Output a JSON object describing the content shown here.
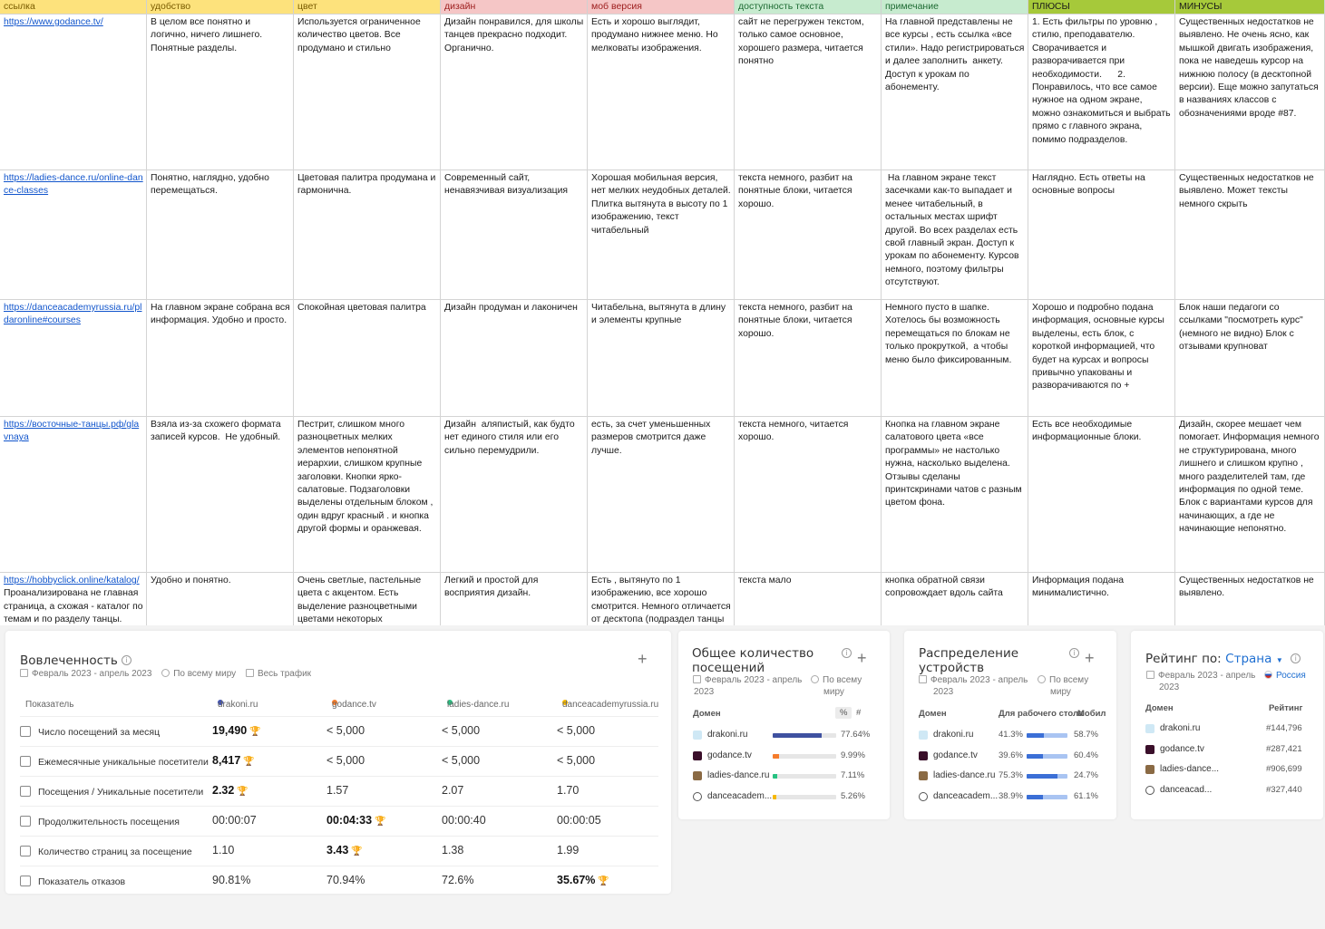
{
  "sheet": {
    "headers": [
      {
        "label": "ссылка",
        "bg": "#fde27c",
        "color": "#7a5c00"
      },
      {
        "label": "удобство",
        "bg": "#fde27c",
        "color": "#7a5c00"
      },
      {
        "label": "цвет",
        "bg": "#fde27c",
        "color": "#7a5c00"
      },
      {
        "label": "дизайн",
        "bg": "#f5c6c6",
        "color": "#9c1c1c"
      },
      {
        "label": "моб версия",
        "bg": "#f5c6c6",
        "color": "#9c1c1c"
      },
      {
        "label": "доступность текста",
        "bg": "#c7ebcf",
        "color": "#1e6b33"
      },
      {
        "label": "примечание",
        "bg": "#c7ebcf",
        "color": "#1e6b33"
      },
      {
        "label": "ПЛЮСЫ",
        "bg": "#a6c93a",
        "color": "#1a1a1a"
      },
      {
        "label": "МИНУСЫ",
        "bg": "#a6c93a",
        "color": "#1a1a1a"
      }
    ],
    "rows": [
      {
        "link": "https://www.godance.tv/",
        "link_note": "",
        "cells": [
          "В целом все понятно и логично, ничего лишнего. Понятные разделы.",
          "Используется ограниченное количество цветов. Все продумано и стильно",
          "Дизайн понравился, для школы танцев прекрасно подходит. Органично.",
          "Есть и хорошо выглядит, продумано нижнее меню. Но мелковаты изображения.",
          "сайт не перегружен текстом, только самое основное, хорошего размера, читается понятно",
          "На главной представлены не все курсы , есть ссылка «все стили». Надо регистрироваться и далее заполнить  анкету. Доступ к урокам по абонементу.",
          "1. Есть фильтры по уровню , стилю, преподавателю. Сворачивается и разворачивается при необходимости.      2. Понравилось, что все самое нужное на одном экране, можно ознакомиться и выбрать прямо с главного экрана, помимо подразделов.",
          "Существенных недостатков не выявлено. Не очень ясно, как мышкой двигать изображения, пока не наведешь курсор на нижнюю полосу (в десктопной версии). Еще можно запутаться в названиях классов с обозначениями вроде #87."
        ]
      },
      {
        "link": "https://ladies-dance.ru/online-dance-classes",
        "link_note": "",
        "cells": [
          "Понятно, наглядно, удобно перемещаться.",
          "Цветовая палитра продумана и гармонична.",
          "Современный сайт, ненавязчивая визуализация",
          "Хорошая мобильная версия, нет мелких неудобных деталей. Плитка вытянута в высоту по 1 изображению, текст читабельный",
          "текста немного, разбит на понятные блоки, читается хорошо.",
          " На главном экране текст засечками как-то выпадает и менее читабельный, в остальных местах шрифт другой. Во всех разделах есть свой главный экран. Доступ к урокам по абонементу. Курсов немного, поэтому фильтры отсутствуют.",
          "Наглядно. Есть ответы на основные вопросы",
          "Существенных недостатков не выявлено. Может тексты немного скрыть"
        ]
      },
      {
        "link": "https://danceacademyrussia.ru/pldaronline#courses",
        "link_note": "",
        "cells": [
          "На главном экране собрана вся информация. Удобно и просто.",
          "Спокойная цветовая палитра",
          "Дизайн продуман и лаконичен",
          "Читабельна, вытянута в длину и элементы крупные",
          "текста немного, разбит на понятные блоки, читается хорошо.",
          "Немного пусто в шапке. Хотелось бы возможность перемещаться по блокам не только прокруткой,  а чтобы меню было фиксированным.",
          "Хорошо и подробно подана информация, основные курсы выделены, есть блок, с короткой информацией, что будет на курсах и вопросы привычно упакованы и разворачиваются по +",
          "Блок наши педагоги со ссылками \"посмотреть курс\" (немного не видно) Блок с отзывами крупноват"
        ]
      },
      {
        "link": "https://восточные-танцы.рф/glavnaya",
        "link_note": "",
        "cells": [
          "Взяла из-за схожего формата записей курсов.  Не удобный.",
          "Пестрит, слишком много разноцветных мелких элементов непонятной иерархии, слишком крупные заголовки. Кнопки ярко-салатовые. Подзаголовки выделены отдельным блоком , один вдруг красный . и кнопка другой формы и оранжевая.",
          "Дизайн  аляпистый, как будто нет единого стиля или его сильно перемудрили.",
          "есть, за счет уменьшенных размеров смотрится даже лучше.",
          "текста немного, читается хорошо.",
          "Кнопка на главном экране салатового цвета «все программы» не настолько нужна, насколько выделена. Отзывы сделаны принтскринами чатов с разным цветом фона.",
          "Есть все необходимые информационные блоки.",
          "Дизайн, скорее мешает чем помогает. Информация немного не структурирована, много лишнего и слишком крупно , много разделителей там, где информация по одной теме. Блок с вариантами курсов для начинающих, а где не начинающие непонятно."
        ]
      },
      {
        "link": "https://hobbyclick.online/katalog/",
        "link_note": "Проанализирована не главная страница, а схожая - каталог по темам и по разделу танцы.",
        "cells": [
          "Удобно и понятно.",
          "Очень светлые, пастельные цвета с акцентом. Есть выделение разноцветными цветами некоторых характеристик -",
          "Легкий и простой для восприятия дизайн.",
          "Есть , вытянуто по 1 изображению, все хорошо смотрится. Немного отличается от десктопа (подраздел танцы",
          "текста мало",
          "кнопка обратной связи сопровождает вдоль сайта",
          "Информация подана минималистично.",
          "Существенных недостатков не выявлено."
        ]
      }
    ]
  },
  "engagement": {
    "title": "Вовлеченность",
    "date_range": "Февраль 2023 - апрель 2023",
    "region": "По всему миру",
    "traffic": "Весь трафик",
    "col_metric": "Показатель",
    "domains": [
      {
        "name": "drakoni.ru",
        "color": "#3f51b5"
      },
      {
        "name": "godance.tv",
        "color": "#f57c2b"
      },
      {
        "name": "ladies-dance.ru",
        "color": "#26c281"
      },
      {
        "name": "danceacademyrussia.ru",
        "color": "#f6b800"
      }
    ],
    "metrics": [
      {
        "label": "Число посещений за месяц",
        "values": [
          "19,490",
          "< 5,000",
          "< 5,000",
          "< 5,000"
        ],
        "winner": 0
      },
      {
        "label": "Ежемесячные уникальные посетители",
        "values": [
          "8,417",
          "< 5,000",
          "< 5,000",
          "< 5,000"
        ],
        "winner": 0
      },
      {
        "label": "Посещения / Уникальные посетители",
        "values": [
          "2.32",
          "1.57",
          "2.07",
          "1.70"
        ],
        "winner": 0
      },
      {
        "label": "Продолжительность посещения",
        "values": [
          "00:00:07",
          "00:04:33",
          "00:00:40",
          "00:00:05"
        ],
        "winner": 1
      },
      {
        "label": "Количество страниц за посещение",
        "values": [
          "1.10",
          "3.43",
          "1.38",
          "1.99"
        ],
        "winner": 1
      },
      {
        "label": "Показатель отказов",
        "values": [
          "90.81%",
          "70.94%",
          "72.6%",
          "35.67%"
        ],
        "winner": 3
      }
    ]
  },
  "visits": {
    "title_line1": "Общее количество",
    "title_line2": "посещений",
    "date_line1": "Февраль 2023 - апрель",
    "date_line2": "2023",
    "region_line1": "По всему",
    "region_line2": "миру",
    "col_domain": "Домен",
    "col_pct": "%",
    "col_hash": "#",
    "rows": [
      {
        "domain": "drakoni.ru",
        "pct": "77.64%",
        "share": 0.7764,
        "color": "#3f51a0"
      },
      {
        "domain": "godance.tv",
        "pct": "9.99%",
        "share": 0.0999,
        "color": "#f57c2b"
      },
      {
        "domain": "ladies-dance.ru",
        "pct": "7.11%",
        "share": 0.0711,
        "color": "#26c281"
      },
      {
        "domain": "danceacadem...",
        "pct": "5.26%",
        "share": 0.0526,
        "color": "#f6b800"
      }
    ]
  },
  "devices": {
    "title_line1": "Распределение",
    "title_line2": "устройств",
    "date_line1": "Февраль 2023 - апрель",
    "date_line2": "2023",
    "region_line1": "По всему",
    "region_line2": "миру",
    "col_domain": "Домен",
    "col_desktop": "Для рабочего стола",
    "col_mobile": "Мобил",
    "rows": [
      {
        "domain": "drakoni.ru",
        "desktop": "41.3%",
        "mobile": "58.7%",
        "desktop_share": 0.413
      },
      {
        "domain": "godance.tv",
        "desktop": "39.6%",
        "mobile": "60.4%",
        "desktop_share": 0.396
      },
      {
        "domain": "ladies-dance.ru",
        "desktop": "75.3%",
        "mobile": "24.7%",
        "desktop_share": 0.753
      },
      {
        "domain": "danceacadem...",
        "desktop": "38.9%",
        "mobile": "61.1%",
        "desktop_share": 0.389
      }
    ]
  },
  "rating": {
    "title_prefix": "Рейтинг по:",
    "title_select": "Страна",
    "date_line1": "Февраль 2023 - апрель",
    "date_line2": "2023",
    "country": "Россия",
    "col_domain": "Домен",
    "col_rank": "Рейтинг",
    "rows": [
      {
        "domain": "drakoni.ru",
        "rank": "#144,796"
      },
      {
        "domain": "godance.tv",
        "rank": "#287,421"
      },
      {
        "domain": "ladies-dance...",
        "rank": "#906,699"
      },
      {
        "domain": "danceacad...",
        "rank": "#327,440"
      }
    ]
  },
  "colors": {
    "accent": "#1f6fd1",
    "desktop_bar": "#3b6fd6",
    "mobile_bar": "#a9c4f2",
    "trophy": "#f0a800"
  }
}
